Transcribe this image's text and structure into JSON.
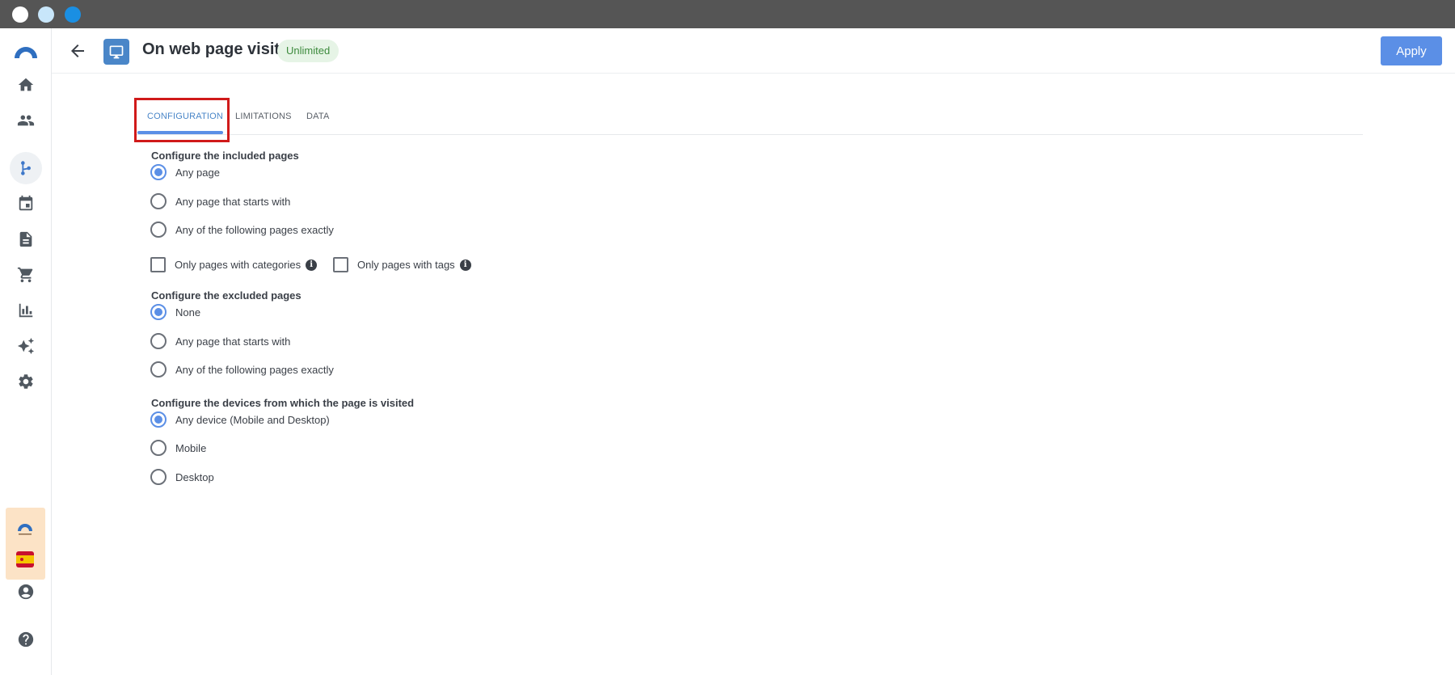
{
  "header": {
    "title": "On web page visit",
    "badge": "Unlimited",
    "apply_label": "Apply"
  },
  "tabs": [
    {
      "label": "CONFIGURATION"
    },
    {
      "label": "LIMITATIONS"
    },
    {
      "label": "DATA"
    }
  ],
  "included": {
    "title": "Configure the included pages",
    "options": [
      {
        "label": "Any page",
        "checked": true
      },
      {
        "label": "Any page that starts with",
        "checked": false
      },
      {
        "label": "Any of the following pages exactly",
        "checked": false
      }
    ],
    "filters": [
      {
        "label": "Only pages with categories",
        "info": "i"
      },
      {
        "label": "Only pages with tags",
        "info": "i"
      }
    ]
  },
  "excluded": {
    "title": "Configure the excluded pages",
    "options": [
      {
        "label": "None",
        "checked": true
      },
      {
        "label": "Any page that starts with",
        "checked": false
      },
      {
        "label": "Any of the following pages exactly",
        "checked": false
      }
    ]
  },
  "devices": {
    "title": "Configure the devices from which the page is visited",
    "options": [
      {
        "label": "Any device (Mobile and Desktop)",
        "checked": true
      },
      {
        "label": "Mobile",
        "checked": false
      },
      {
        "label": "Desktop",
        "checked": false
      }
    ]
  },
  "sidebar": {
    "items": [
      {
        "icon": "home-icon"
      },
      {
        "icon": "people-icon"
      },
      {
        "icon": "workflow-icon",
        "active": true
      },
      {
        "icon": "calendar-icon"
      },
      {
        "icon": "document-icon"
      },
      {
        "icon": "cart-icon"
      },
      {
        "icon": "chart-icon"
      },
      {
        "icon": "sparkle-icon"
      },
      {
        "icon": "gear-icon"
      },
      {
        "icon": "account-icon"
      },
      {
        "icon": "help-icon"
      }
    ]
  },
  "colors": {
    "accent": "#5b8fe6",
    "highlight": "#d01a1a",
    "badge_bg": "#e6f4e6",
    "badge_text": "#3d8a3d"
  }
}
